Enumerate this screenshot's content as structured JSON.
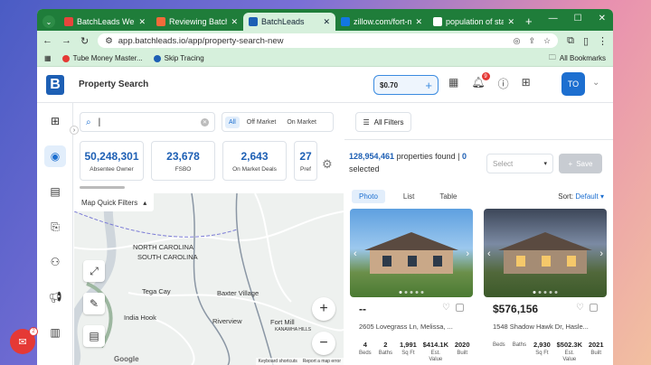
{
  "browser": {
    "tabs": [
      {
        "title": "BatchLeads Webinar",
        "color": "#e8453c"
      },
      {
        "title": "Reviewing BatchLeads",
        "color": "#f26b3a"
      },
      {
        "title": "BatchLeads",
        "color": "#1d5fb4"
      },
      {
        "title": "zillow.com/fort-mill",
        "color": "#1277e1"
      },
      {
        "title": "population of stanfield",
        "color": "#ffffff"
      }
    ],
    "url": "app.batchleads.io/app/property-search-new",
    "bookmarks": [
      "Tube Money Master...",
      "Skip Tracing"
    ],
    "all_bookmarks": "All Bookmarks"
  },
  "header": {
    "page_title": "Property Search",
    "credit": "$0.70",
    "notif_count": "9",
    "avatar": "TO"
  },
  "search": {
    "placeholder": "",
    "segments": [
      "All",
      "Off Market",
      "On Market"
    ]
  },
  "stats": [
    {
      "value": "50,248,301",
      "label": "Absentee Owner"
    },
    {
      "value": "23,678",
      "label": "FSBO"
    },
    {
      "value": "2,643",
      "label": "On Market Deals"
    },
    {
      "value": "27",
      "label": "Pref"
    }
  ],
  "map": {
    "quick_filters": "Map Quick Filters",
    "labels": [
      "NORTH CAROLINA",
      "SOUTH CAROLINA",
      "Tega Cay",
      "Baxter Village",
      "India Hook",
      "Riverview",
      "Fort Mill",
      "KANAWHA HILLS",
      "Google"
    ],
    "footer": [
      "Keyboard shortcuts",
      "Report a map error"
    ]
  },
  "results": {
    "filters_label": "All Filters",
    "count": "128,954,461",
    "found_text": "properties found",
    "selected_count": "0",
    "selected_text": "selected",
    "select_placeholder": "Select",
    "save_label": "Save",
    "view_tabs": [
      "Photo",
      "List",
      "Table"
    ],
    "sort_label": "Sort:",
    "sort_value": "Default"
  },
  "cards": [
    {
      "price": "--",
      "address": "2605 Lovegrass Ln, Melissa, ...",
      "facts": [
        {
          "v": "4",
          "k": "Beds"
        },
        {
          "v": "2",
          "k": "Baths"
        },
        {
          "v": "1,991",
          "k": "Sq Ft"
        },
        {
          "v": "$414.1K",
          "k": "Est. Value"
        },
        {
          "v": "2020",
          "k": "Built"
        }
      ]
    },
    {
      "price": "$576,156",
      "address": "1548 Shadow Hawk Dr, Hasle...",
      "facts": [
        {
          "v": "",
          "k": "Beds"
        },
        {
          "v": "",
          "k": "Baths"
        },
        {
          "v": "2,930",
          "k": "Sq Ft"
        },
        {
          "v": "$502.3K",
          "k": "Est. Value"
        },
        {
          "v": "2021",
          "k": "Built"
        }
      ]
    }
  ],
  "help_badge": "2"
}
